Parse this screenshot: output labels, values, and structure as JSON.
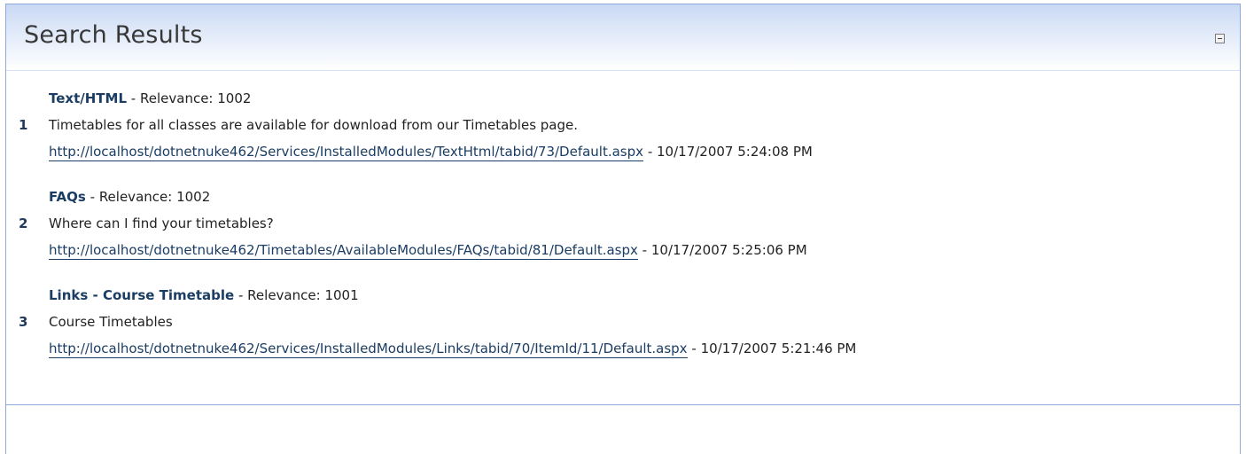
{
  "module": {
    "title": "Search Results",
    "collapse_icon": "minus-box-icon"
  },
  "results": [
    {
      "number": "1",
      "title": "Text/HTML",
      "relevance_label": "Relevance:",
      "relevance": "1002",
      "description": "Timetables for all classes are available for download from our Timetables page.",
      "url": "http://localhost/dotnetnuke462/Services/InstalledModules/TextHtml/tabid/73/Default.aspx",
      "date": "10/17/2007 5:24:08 PM"
    },
    {
      "number": "2",
      "title": "FAQs",
      "relevance_label": "Relevance:",
      "relevance": "1002",
      "description": "Where can I find your timetables?",
      "url": "http://localhost/dotnetnuke462/Timetables/AvailableModules/FAQs/tabid/81/Default.aspx",
      "date": "10/17/2007 5:25:06 PM"
    },
    {
      "number": "3",
      "title": "Links - Course Timetable",
      "relevance_label": "Relevance:",
      "relevance": "1001",
      "description": "Course Timetables",
      "url": "http://localhost/dotnetnuke462/Services/InstalledModules/Links/tabid/70/ItemId/11/Default.aspx",
      "date": "10/17/2007 5:21:46 PM"
    }
  ],
  "separator": "-",
  "colors": {
    "header_gradient_top": "#c9d8f4",
    "title_text": "#383838",
    "link": "#1b3d63",
    "border": "#8eaadb"
  }
}
